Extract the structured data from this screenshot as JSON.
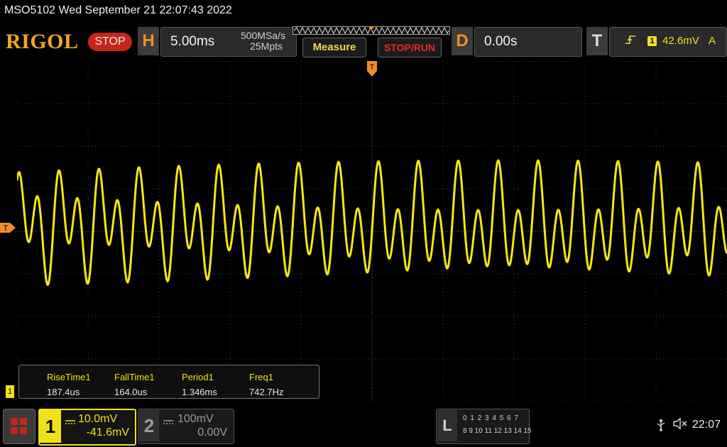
{
  "header": {
    "info_line": "MSO5102  Wed September 21 22:07:43 2022",
    "logo": "RIGOL",
    "status": "STOP"
  },
  "horizontal": {
    "label": "H",
    "timebase": "5.00ms",
    "sample_rate": "500MSa/s",
    "memory_depth": "25Mpts"
  },
  "buttons": {
    "measure": "Measure",
    "stop_run": "STOP/RUN"
  },
  "delay": {
    "label": "D",
    "value": "0.00s"
  },
  "trigger": {
    "label": "T",
    "edge_icon": "rising-edge-icon",
    "source": "1",
    "level": "42.6mV",
    "mode": "A"
  },
  "markers": {
    "trigger_position": "T",
    "trigger_level": "T",
    "ch1": "1"
  },
  "measurements": [
    {
      "label": "RiseTime1",
      "value": "187.4us"
    },
    {
      "label": "FallTime1",
      "value": "164.0us"
    },
    {
      "label": "Period1",
      "value": "1.346ms"
    },
    {
      "label": "Freq1",
      "value": "742.7Hz"
    }
  ],
  "channels": {
    "ch1": {
      "number": "1",
      "scale": "10.0mV",
      "offset": "-41.6mV",
      "color": "#f0e11a"
    },
    "ch2": {
      "number": "2",
      "scale": "100mV",
      "offset": "0.00V",
      "color": "#9a9a9a"
    }
  },
  "logic": {
    "label": "L",
    "row1": "0 1 2 3   4 5 6 7",
    "row2": "8 9 10 11 12 13 14 15"
  },
  "system": {
    "clock": "22:07",
    "usb_icon": "usb-icon",
    "mute_icon": "speaker-mute-icon"
  }
}
